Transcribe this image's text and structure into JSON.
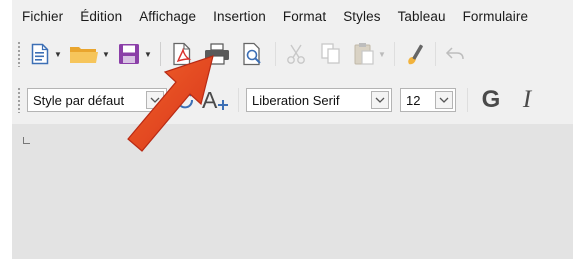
{
  "menubar": {
    "items": [
      {
        "label": "Fichier"
      },
      {
        "label": "Édition"
      },
      {
        "label": "Affichage"
      },
      {
        "label": "Insertion"
      },
      {
        "label": "Format"
      },
      {
        "label": "Styles"
      },
      {
        "label": "Tableau"
      },
      {
        "label": "Formulaire"
      }
    ]
  },
  "toolbar_standard": {
    "buttons": [
      "new-document",
      "open",
      "save",
      "export-pdf",
      "print",
      "print-preview",
      "cut",
      "copy",
      "paste",
      "clone-formatting",
      "undo"
    ]
  },
  "toolbar_formatting": {
    "paragraph_style": "Style par défaut",
    "font_name": "Liberation Serif",
    "font_size": "12",
    "bold_label": "G",
    "italic_label": "I"
  },
  "colors": {
    "arrow": "#e8431c",
    "pdf_accent": "#d9302c",
    "save_purple": "#8b3fa8",
    "folder_yellow": "#f2b33d",
    "doc_blue": "#3c6fb5"
  }
}
